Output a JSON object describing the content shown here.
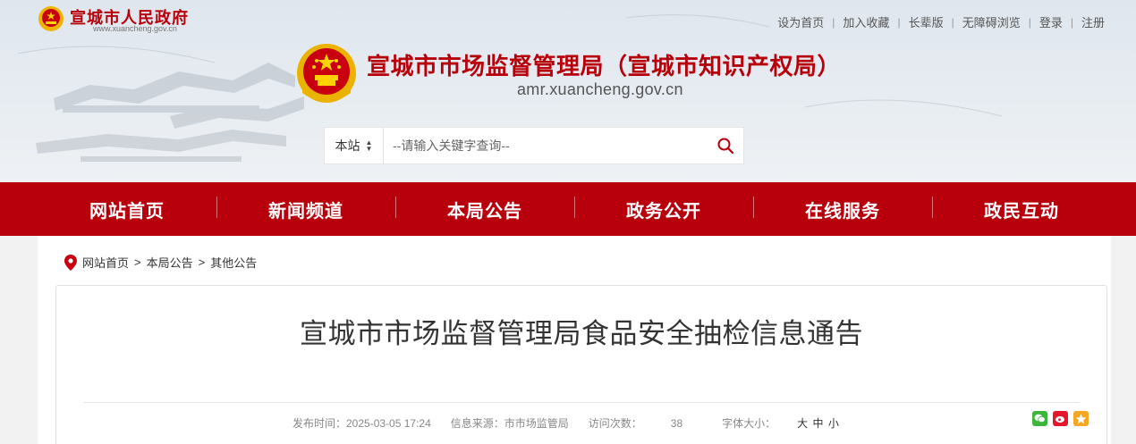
{
  "site": {
    "city_name": "宣城市人民政府",
    "city_url": "www.xuancheng.gov.cn",
    "bureau_name": "宣城市市场监督管理局（宣城市知识产权局）",
    "bureau_url": "amr.xuancheng.gov.cn"
  },
  "toplinks": [
    "设为首页",
    "加入收藏",
    "长辈版",
    "无障碍浏览",
    "登录",
    "注册"
  ],
  "search": {
    "scope": "本站",
    "placeholder": "--请输入关键字查询--"
  },
  "nav": [
    "网站首页",
    "新闻频道",
    "本局公告",
    "政务公开",
    "在线服务",
    "政民互动"
  ],
  "breadcrumb": [
    "网站首页",
    "本局公告",
    "其他公告"
  ],
  "article": {
    "title": "宣城市市场监督管理局食品安全抽检信息通告",
    "publish_label": "发布时间：2025-03-05 17:24",
    "source_label": "信息来源：市市场监管局",
    "views_label": "访问次数：",
    "views_value": "38",
    "fontsize_label": "字体大小：",
    "fontsize_options": [
      "大",
      "中",
      "小"
    ]
  },
  "colors": {
    "brand_red": "#b7000b",
    "wechat": "#3bb53a",
    "weibo": "#e6162d",
    "qzone": "#f5a623"
  },
  "share_icons": [
    "wechat-icon",
    "weibo-icon",
    "qzone-icon"
  ]
}
